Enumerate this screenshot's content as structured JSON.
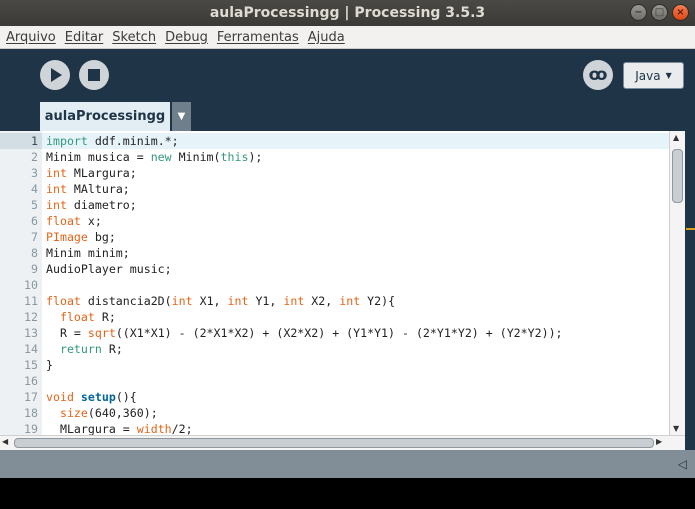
{
  "window": {
    "title": "aulaProcessingg | Processing 3.5.3",
    "controls": [
      "minimize",
      "maximize",
      "close"
    ],
    "minimize_glyph": "−",
    "maximize_glyph": "□",
    "close_glyph": "×"
  },
  "menu": [
    "Arquivo",
    "Editar",
    "Sketch",
    "Debug",
    "Ferramentas",
    "Ajuda"
  ],
  "toolbar": {
    "run_icon": "play-icon",
    "stop_icon": "stop-icon",
    "debug_icon": "butterfly-icon",
    "debug_glyph": "ꝏ",
    "mode_label": "Java",
    "mode_caret": "▼"
  },
  "tab": {
    "name": "aulaProcessingg",
    "menu_caret": "▼"
  },
  "editor": {
    "current_line": 1,
    "lines": [
      {
        "n": "1",
        "text": "import ddf.minim.*;"
      },
      {
        "n": "2",
        "text": "Minim musica = new Minim(this);"
      },
      {
        "n": "3",
        "text": "int MLargura;"
      },
      {
        "n": "4",
        "text": "int MAltura;"
      },
      {
        "n": "5",
        "text": "int diametro;"
      },
      {
        "n": "6",
        "text": "float x;"
      },
      {
        "n": "7",
        "text": "PImage bg;"
      },
      {
        "n": "8",
        "text": "Minim minim;"
      },
      {
        "n": "9",
        "text": "AudioPlayer music;"
      },
      {
        "n": "10",
        "text": ""
      },
      {
        "n": "11",
        "text": "float distancia2D(int X1, int Y1, int X2, int Y2){"
      },
      {
        "n": "12",
        "text": "  float R;"
      },
      {
        "n": "13",
        "text": "  R = sqrt((X1*X1) - (2*X1*X2) + (X2*X2) + (Y1*Y1) - (2*Y1*Y2) + (Y2*Y2));"
      },
      {
        "n": "14",
        "text": "  return R;"
      },
      {
        "n": "15",
        "text": "}"
      },
      {
        "n": "16",
        "text": ""
      },
      {
        "n": "17",
        "text": "void setup(){"
      },
      {
        "n": "18",
        "text": "  size(640,360);"
      },
      {
        "n": "19",
        "text": "  MLargura = width/2;"
      }
    ]
  },
  "scroll": {
    "up": "▲",
    "down": "▼",
    "left": "◀",
    "right": "▶"
  },
  "console": {
    "toggle_glyph": "◁"
  },
  "colors": {
    "toolbar_bg": "#1f3547",
    "keyword": "#33997e",
    "type": "#e2661a",
    "function": "#006699"
  }
}
